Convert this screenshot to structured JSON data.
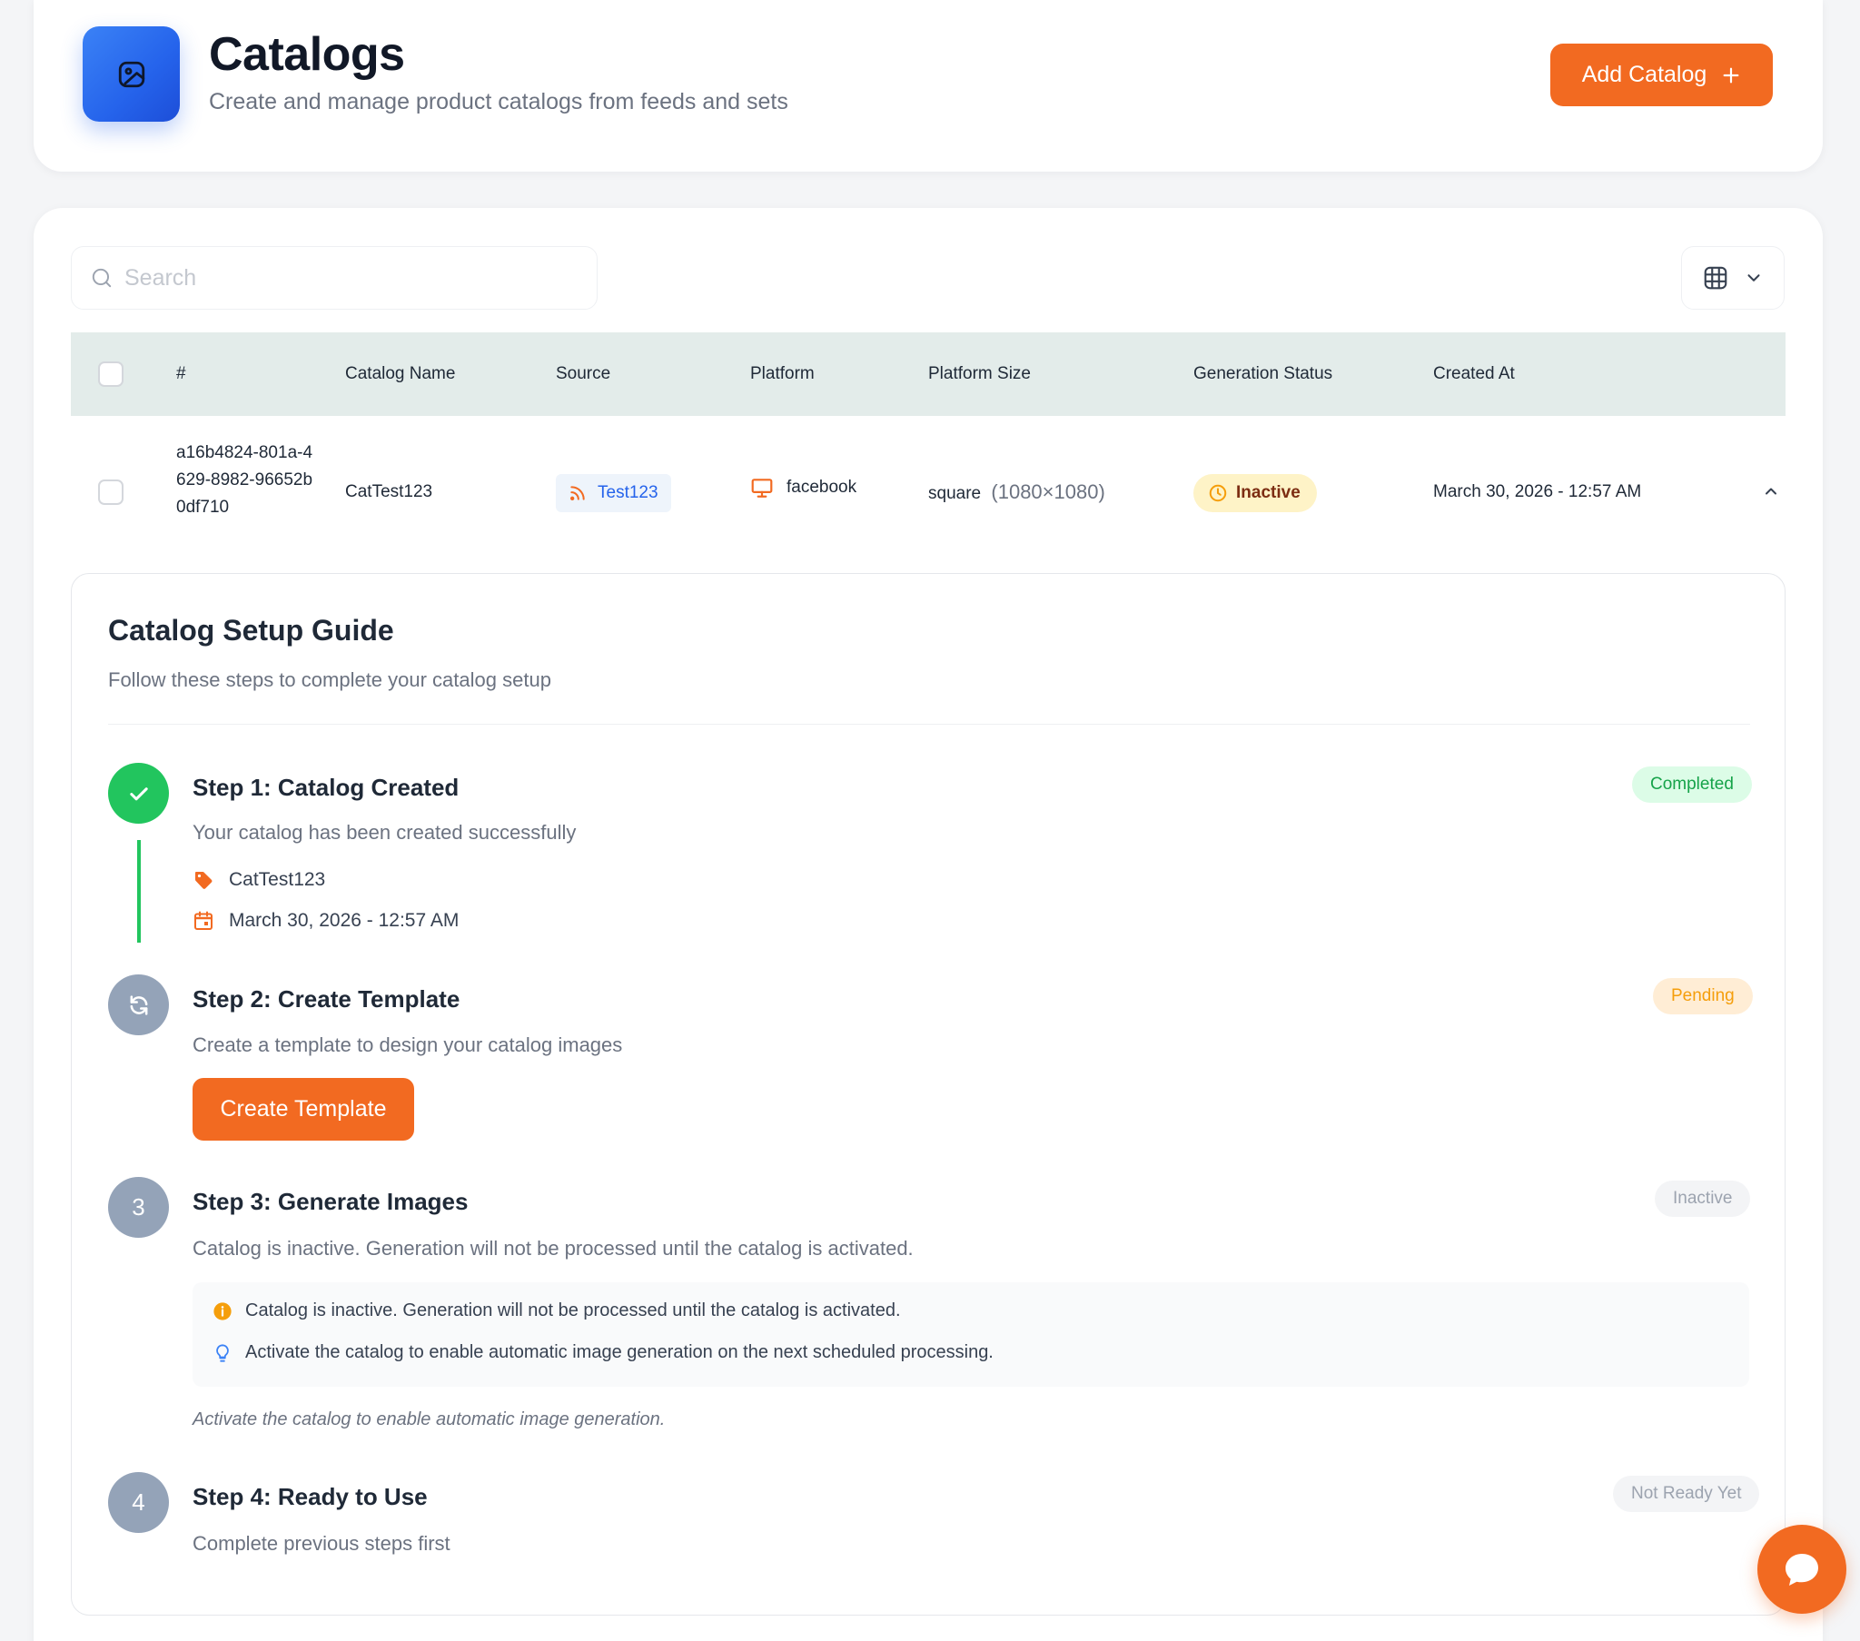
{
  "header": {
    "title": "Catalogs",
    "subtitle": "Create and manage product catalogs from feeds and sets",
    "add_button_label": "Add Catalog",
    "logo_icon": "catalog-image-icon",
    "accent_color": "#f26a21",
    "logo_color": "#2563eb"
  },
  "search": {
    "placeholder": "Search"
  },
  "table": {
    "columns": [
      "#",
      "Catalog Name",
      "Source",
      "Platform",
      "Platform Size",
      "Generation Status",
      "Created At"
    ],
    "header_bg": "#e3ecea",
    "rows": [
      {
        "id": "a16b4824-801a-4629-8982-96652b0df710",
        "catalog_name": "CatTest123",
        "source": "Test123",
        "source_icon": "rss-feed-icon",
        "platform": "facebook",
        "platform_icon": "monitor-icon",
        "size_name": "square",
        "size_dims": "(1080×1080)",
        "generation_status": "Inactive",
        "created_at": "March 30, 2026 - 12:57 AM"
      }
    ]
  },
  "guide": {
    "title": "Catalog Setup Guide",
    "subtitle": "Follow these steps to complete your catalog setup",
    "steps": [
      {
        "title": "Step 1: Catalog Created",
        "description": "Your catalog has been created successfully",
        "status": "Completed",
        "catalog_name": "CatTest123",
        "created_at": "March 30, 2026 - 12:57 AM"
      },
      {
        "title": "Step 2: Create Template",
        "description": "Create a template to design your catalog images",
        "status": "Pending",
        "button_label": "Create Template"
      },
      {
        "number": "3",
        "title": "Step 3: Generate Images",
        "description": "Catalog is inactive. Generation will not be processed until the catalog is activated.",
        "status": "Inactive",
        "notes": [
          "Catalog is inactive. Generation will not be processed until the catalog is activated.",
          "Activate the catalog to enable automatic image generation on the next scheduled processing."
        ],
        "hint": "Activate the catalog to enable automatic image generation."
      },
      {
        "number": "4",
        "title": "Step 4: Ready to Use",
        "description": "Complete previous steps first",
        "status": "Not Ready Yet"
      }
    ]
  },
  "colors": {
    "completed": "#22c55e",
    "pending": "#f59e0b",
    "inactive_step": "#94a3b8"
  }
}
